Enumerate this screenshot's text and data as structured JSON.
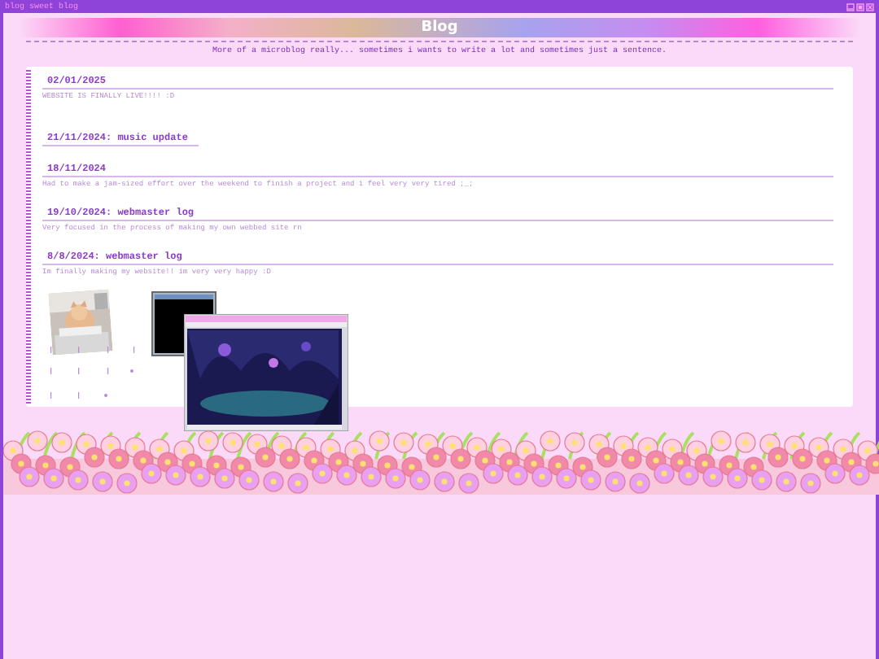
{
  "window": {
    "title": "blog sweet blog"
  },
  "banner": {
    "title": "Blog",
    "subtitle": "More of a microblog really... sometimes i wants to write a lot and sometimes just a sentence."
  },
  "posts": [
    {
      "heading": "02/01/2025",
      "body": "WEBSITE IS FINALLY LIVE!!!! :D"
    },
    {
      "heading": "21/11/2024: music update"
    },
    {
      "heading": "18/11/2024",
      "body": "Had to make a jam-sized effort over the weekend to finish a project and i feel very very tired ;_;"
    },
    {
      "heading": "19/10/2024: webmaster log",
      "body": "Very focused in the process of making my own webbed site rn"
    },
    {
      "heading": "8/8/2024: webmaster log",
      "body": "Im finally making my website!! im very very happy :D"
    }
  ]
}
